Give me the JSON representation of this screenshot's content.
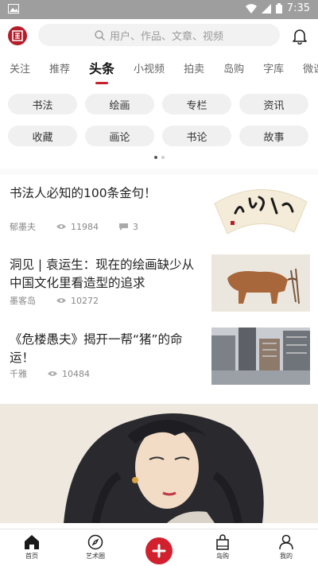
{
  "status": {
    "time": "7:35"
  },
  "search": {
    "placeholder": "用户、作品、文章、视频"
  },
  "tabs": [
    "关注",
    "推荐",
    "头条",
    "小视频",
    "拍卖",
    "岛购",
    "字库",
    "微课"
  ],
  "active_tab": "头条",
  "chips": [
    "书法",
    "绘画",
    "专栏",
    "资讯",
    "收藏",
    "画论",
    "书论",
    "故事"
  ],
  "articles": [
    {
      "title": "书法人必知的100条金句！",
      "author": "郁墨夫",
      "views": "11984",
      "comments": "3"
    },
    {
      "title": "洞见 | 袁运生：现在的绘画缺少从中国文化里看造型的追求",
      "author": "墨客岛",
      "views": "10272"
    },
    {
      "title": "《危楼愚夫》揭开一帮“猪”的命运！",
      "author": "千雅",
      "views": "10484"
    }
  ],
  "bottom_nav": [
    "首页",
    "艺术圈",
    "",
    "岛购",
    "我的"
  ],
  "colors": {
    "accent": "#c8202f",
    "plus": "#d1202e"
  }
}
